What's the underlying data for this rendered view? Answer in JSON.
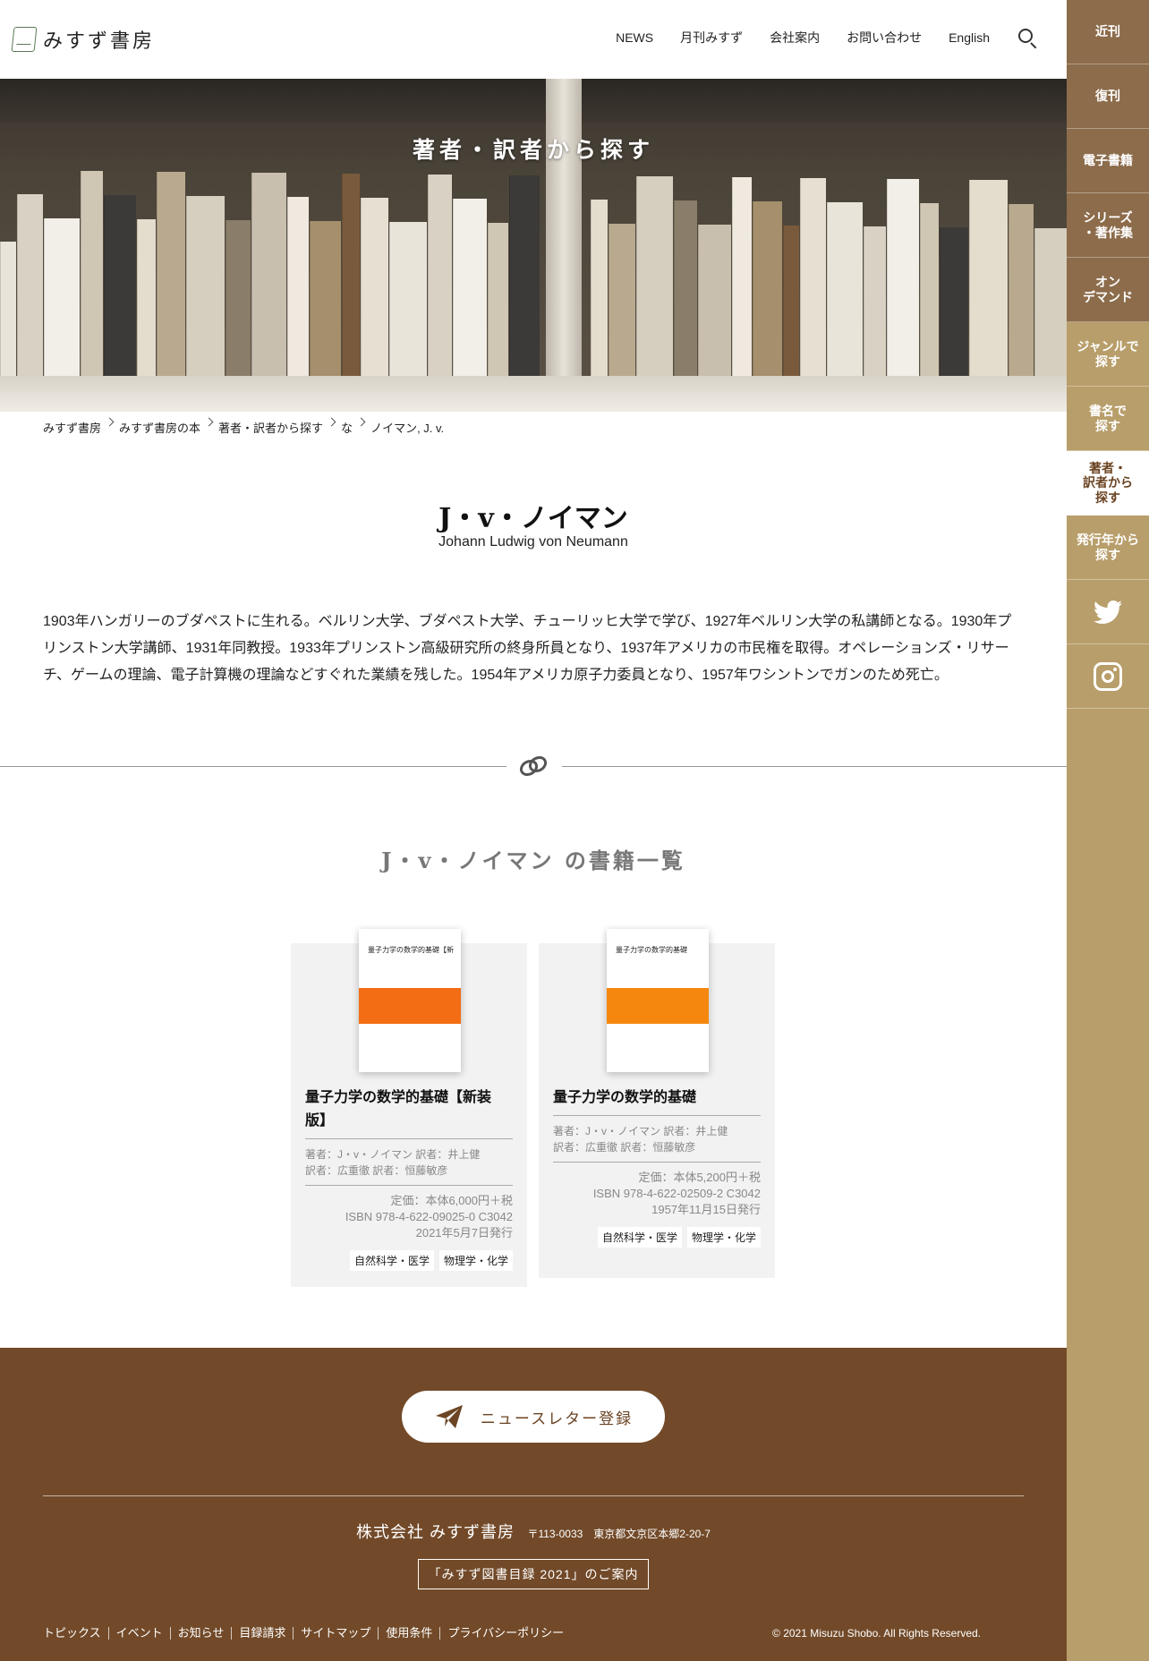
{
  "header": {
    "logo_text": "みすず書房",
    "nav": [
      "NEWS",
      "月刊みすず",
      "会社案内",
      "お問い合わせ",
      "English"
    ]
  },
  "sidenav": {
    "items": [
      "近刊",
      "復刊",
      "電子書籍",
      "シリーズ\n・著作集",
      "オン\nデマンド",
      "ジャンルで\n探す",
      "書名で\n探す",
      "著者・\n訳者から\n探す",
      "発行年から\n探す"
    ],
    "active_index": 7
  },
  "hero": {
    "title": "著者・訳者から探す"
  },
  "breadcrumb": [
    "みすず書房",
    "みすず書房の本",
    "著者・訳者から探す",
    "な",
    "ノイマン, J. v."
  ],
  "author": {
    "name": "J・v・ノイマン",
    "name_en": "Johann Ludwig von Neumann",
    "bio": "1903年ハンガリーのブダペストに生れる。ベルリン大学、ブダペスト大学、チューリッヒ大学で学び、1927年ベルリン大学の私講師となる。1930年プリンストン大学講師、1931年同教授。1933年プリンストン高級研究所の終身所員となり、1937年アメリカの市民権を取得。オペレーションズ・リサーチ、ゲームの理論、電子計算機の理論などすぐれた業績を残した。1954年アメリカ原子力委員となり、1957年ワシントンでガンのため死亡。"
  },
  "book_list": {
    "title": "J・v・ノイマン の書籍一覧",
    "books": [
      {
        "title": "量子力学の数学的基礎【新装版】",
        "people_line1": "著者：J・v・ノイマン  訳者：井上健",
        "people_line2": "訳者：広重徹  訳者：恒藤敏彦",
        "price": "定価：本体6,000円＋税",
        "isbn": "ISBN 978-4-622-09025-0 C3042",
        "date": "2021年5月7日発行",
        "tags": [
          "自然科学・医学",
          "物理学・化学"
        ],
        "cover_band_color": "#f26d13"
      },
      {
        "title": "量子力学の数学的基礎",
        "people_line1": "著者：J・v・ノイマン  訳者：井上健",
        "people_line2": "訳者：広重徹  訳者：恒藤敏彦",
        "price": "定価：本体5,200円＋税",
        "isbn": "ISBN 978-4-622-02509-2 C3042",
        "date": "1957年11月15日発行",
        "tags": [
          "自然科学・医学",
          "物理学・化学"
        ],
        "cover_band_color": "#f5870e"
      }
    ]
  },
  "footer": {
    "newsletter_label": "ニュースレター登録",
    "company_name": "株式会社 みすず書房",
    "company_address": "〒113-0033　東京都文京区本郷2-20-7",
    "catalog_label": "「みすず図書目録 2021」のご案内",
    "links": [
      "トピックス",
      "イベント",
      "お知らせ",
      "目録請求",
      "サイトマップ",
      "使用条件",
      "プライバシーポリシー"
    ],
    "copyright": "© 2021 Misuzu Shobo. All Rights Reserved."
  }
}
